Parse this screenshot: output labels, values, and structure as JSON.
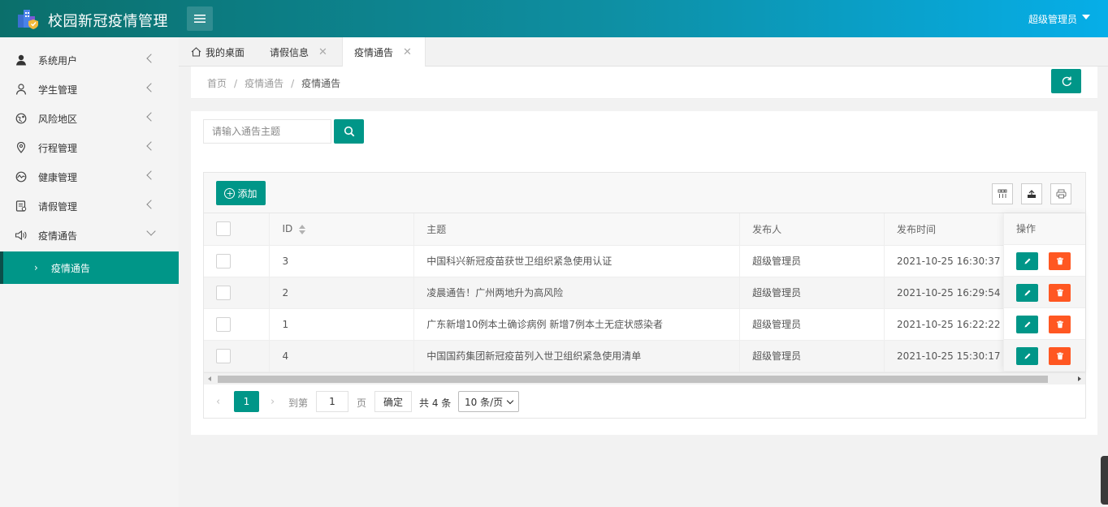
{
  "app": {
    "title": "校园新冠疫情管理",
    "user": "超级管理员"
  },
  "sidebar": {
    "items": [
      {
        "label": "系统用户",
        "icon": "user-icon"
      },
      {
        "label": "学生管理",
        "icon": "student-icon"
      },
      {
        "label": "风险地区",
        "icon": "risk-area-icon"
      },
      {
        "label": "行程管理",
        "icon": "location-icon"
      },
      {
        "label": "健康管理",
        "icon": "health-icon"
      },
      {
        "label": "请假管理",
        "icon": "leave-icon"
      },
      {
        "label": "疫情通告",
        "icon": "speaker-icon"
      }
    ],
    "sub_item": "疫情通告"
  },
  "tabs": [
    {
      "label": "我的桌面"
    },
    {
      "label": "请假信息"
    },
    {
      "label": "疫情通告"
    }
  ],
  "breadcrumb": {
    "home": "首页",
    "parent": "疫情通告",
    "current": "疫情通告"
  },
  "search": {
    "placeholder": "请输入通告主题",
    "value": ""
  },
  "toolbar": {
    "add_label": "添加"
  },
  "table": {
    "columns": {
      "id": "ID",
      "subject": "主题",
      "publisher": "发布人",
      "time": "发布时间",
      "ops": "操作"
    },
    "rows": [
      {
        "id": "3",
        "subject": "中国科兴新冠疫苗获世卫组织紧急使用认证",
        "publisher": "超级管理员",
        "time": "2021-10-25 16:30:37"
      },
      {
        "id": "2",
        "subject": "凌晨通告！广州两地升为高风险",
        "publisher": "超级管理员",
        "time": "2021-10-25 16:29:54"
      },
      {
        "id": "1",
        "subject": "广东新增10例本土确诊病例 新增7例本土无症状感染者",
        "publisher": "超级管理员",
        "time": "2021-10-25 16:22:22"
      },
      {
        "id": "4",
        "subject": "中国国药集团新冠疫苗列入世卫组织紧急使用清单",
        "publisher": "超级管理员",
        "time": "2021-10-25 15:30:17"
      }
    ]
  },
  "pagination": {
    "current": "1",
    "goto_label": "到第",
    "goto_value": "1",
    "page_label": "页",
    "confirm_label": "确定",
    "total": "共 4 条",
    "page_size": "10 条/页"
  },
  "colors": {
    "primary": "#009688",
    "danger": "#ff5722",
    "header_start": "#0b6f6b",
    "header_end": "#06aee8"
  }
}
